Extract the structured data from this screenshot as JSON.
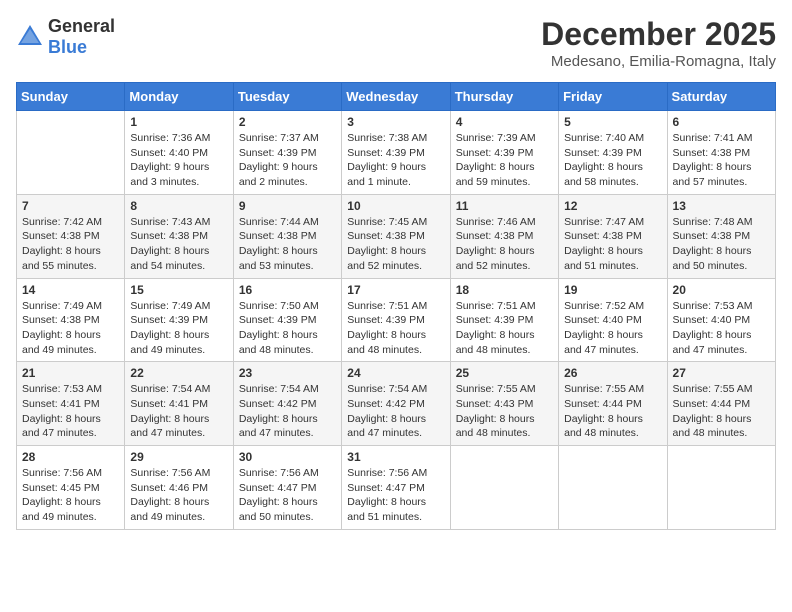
{
  "logo": {
    "general": "General",
    "blue": "Blue"
  },
  "title": {
    "month": "December 2025",
    "location": "Medesano, Emilia-Romagna, Italy"
  },
  "weekdays": [
    "Sunday",
    "Monday",
    "Tuesday",
    "Wednesday",
    "Thursday",
    "Friday",
    "Saturday"
  ],
  "weeks": [
    [
      {
        "day": "",
        "sunrise": "",
        "sunset": "",
        "daylight": ""
      },
      {
        "day": "1",
        "sunrise": "Sunrise: 7:36 AM",
        "sunset": "Sunset: 4:40 PM",
        "daylight": "Daylight: 9 hours and 3 minutes."
      },
      {
        "day": "2",
        "sunrise": "Sunrise: 7:37 AM",
        "sunset": "Sunset: 4:39 PM",
        "daylight": "Daylight: 9 hours and 2 minutes."
      },
      {
        "day": "3",
        "sunrise": "Sunrise: 7:38 AM",
        "sunset": "Sunset: 4:39 PM",
        "daylight": "Daylight: 9 hours and 1 minute."
      },
      {
        "day": "4",
        "sunrise": "Sunrise: 7:39 AM",
        "sunset": "Sunset: 4:39 PM",
        "daylight": "Daylight: 8 hours and 59 minutes."
      },
      {
        "day": "5",
        "sunrise": "Sunrise: 7:40 AM",
        "sunset": "Sunset: 4:39 PM",
        "daylight": "Daylight: 8 hours and 58 minutes."
      },
      {
        "day": "6",
        "sunrise": "Sunrise: 7:41 AM",
        "sunset": "Sunset: 4:38 PM",
        "daylight": "Daylight: 8 hours and 57 minutes."
      }
    ],
    [
      {
        "day": "7",
        "sunrise": "Sunrise: 7:42 AM",
        "sunset": "Sunset: 4:38 PM",
        "daylight": "Daylight: 8 hours and 55 minutes."
      },
      {
        "day": "8",
        "sunrise": "Sunrise: 7:43 AM",
        "sunset": "Sunset: 4:38 PM",
        "daylight": "Daylight: 8 hours and 54 minutes."
      },
      {
        "day": "9",
        "sunrise": "Sunrise: 7:44 AM",
        "sunset": "Sunset: 4:38 PM",
        "daylight": "Daylight: 8 hours and 53 minutes."
      },
      {
        "day": "10",
        "sunrise": "Sunrise: 7:45 AM",
        "sunset": "Sunset: 4:38 PM",
        "daylight": "Daylight: 8 hours and 52 minutes."
      },
      {
        "day": "11",
        "sunrise": "Sunrise: 7:46 AM",
        "sunset": "Sunset: 4:38 PM",
        "daylight": "Daylight: 8 hours and 52 minutes."
      },
      {
        "day": "12",
        "sunrise": "Sunrise: 7:47 AM",
        "sunset": "Sunset: 4:38 PM",
        "daylight": "Daylight: 8 hours and 51 minutes."
      },
      {
        "day": "13",
        "sunrise": "Sunrise: 7:48 AM",
        "sunset": "Sunset: 4:38 PM",
        "daylight": "Daylight: 8 hours and 50 minutes."
      }
    ],
    [
      {
        "day": "14",
        "sunrise": "Sunrise: 7:49 AM",
        "sunset": "Sunset: 4:38 PM",
        "daylight": "Daylight: 8 hours and 49 minutes."
      },
      {
        "day": "15",
        "sunrise": "Sunrise: 7:49 AM",
        "sunset": "Sunset: 4:39 PM",
        "daylight": "Daylight: 8 hours and 49 minutes."
      },
      {
        "day": "16",
        "sunrise": "Sunrise: 7:50 AM",
        "sunset": "Sunset: 4:39 PM",
        "daylight": "Daylight: 8 hours and 48 minutes."
      },
      {
        "day": "17",
        "sunrise": "Sunrise: 7:51 AM",
        "sunset": "Sunset: 4:39 PM",
        "daylight": "Daylight: 8 hours and 48 minutes."
      },
      {
        "day": "18",
        "sunrise": "Sunrise: 7:51 AM",
        "sunset": "Sunset: 4:39 PM",
        "daylight": "Daylight: 8 hours and 48 minutes."
      },
      {
        "day": "19",
        "sunrise": "Sunrise: 7:52 AM",
        "sunset": "Sunset: 4:40 PM",
        "daylight": "Daylight: 8 hours and 47 minutes."
      },
      {
        "day": "20",
        "sunrise": "Sunrise: 7:53 AM",
        "sunset": "Sunset: 4:40 PM",
        "daylight": "Daylight: 8 hours and 47 minutes."
      }
    ],
    [
      {
        "day": "21",
        "sunrise": "Sunrise: 7:53 AM",
        "sunset": "Sunset: 4:41 PM",
        "daylight": "Daylight: 8 hours and 47 minutes."
      },
      {
        "day": "22",
        "sunrise": "Sunrise: 7:54 AM",
        "sunset": "Sunset: 4:41 PM",
        "daylight": "Daylight: 8 hours and 47 minutes."
      },
      {
        "day": "23",
        "sunrise": "Sunrise: 7:54 AM",
        "sunset": "Sunset: 4:42 PM",
        "daylight": "Daylight: 8 hours and 47 minutes."
      },
      {
        "day": "24",
        "sunrise": "Sunrise: 7:54 AM",
        "sunset": "Sunset: 4:42 PM",
        "daylight": "Daylight: 8 hours and 47 minutes."
      },
      {
        "day": "25",
        "sunrise": "Sunrise: 7:55 AM",
        "sunset": "Sunset: 4:43 PM",
        "daylight": "Daylight: 8 hours and 48 minutes."
      },
      {
        "day": "26",
        "sunrise": "Sunrise: 7:55 AM",
        "sunset": "Sunset: 4:44 PM",
        "daylight": "Daylight: 8 hours and 48 minutes."
      },
      {
        "day": "27",
        "sunrise": "Sunrise: 7:55 AM",
        "sunset": "Sunset: 4:44 PM",
        "daylight": "Daylight: 8 hours and 48 minutes."
      }
    ],
    [
      {
        "day": "28",
        "sunrise": "Sunrise: 7:56 AM",
        "sunset": "Sunset: 4:45 PM",
        "daylight": "Daylight: 8 hours and 49 minutes."
      },
      {
        "day": "29",
        "sunrise": "Sunrise: 7:56 AM",
        "sunset": "Sunset: 4:46 PM",
        "daylight": "Daylight: 8 hours and 49 minutes."
      },
      {
        "day": "30",
        "sunrise": "Sunrise: 7:56 AM",
        "sunset": "Sunset: 4:47 PM",
        "daylight": "Daylight: 8 hours and 50 minutes."
      },
      {
        "day": "31",
        "sunrise": "Sunrise: 7:56 AM",
        "sunset": "Sunset: 4:47 PM",
        "daylight": "Daylight: 8 hours and 51 minutes."
      },
      {
        "day": "",
        "sunrise": "",
        "sunset": "",
        "daylight": ""
      },
      {
        "day": "",
        "sunrise": "",
        "sunset": "",
        "daylight": ""
      },
      {
        "day": "",
        "sunrise": "",
        "sunset": "",
        "daylight": ""
      }
    ]
  ]
}
